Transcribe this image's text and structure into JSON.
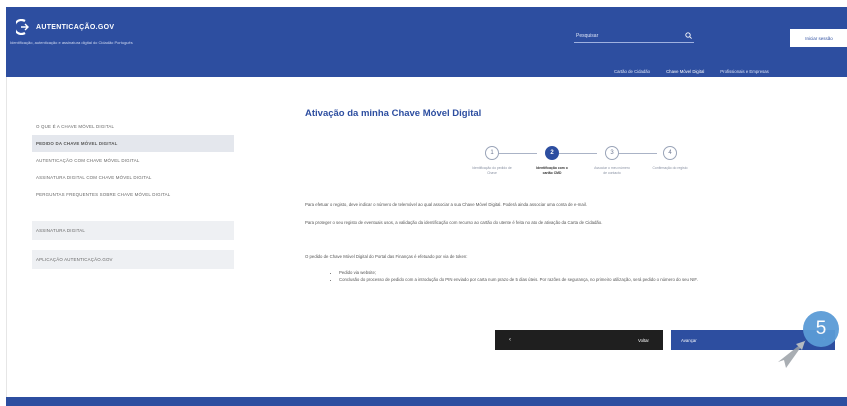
{
  "header": {
    "brand_name": "AUTENTICAÇÃO.GOV",
    "brand_sub": "Identificação, autenticação e assinatura digital do Cidadão Português",
    "search_placeholder": "Pesquisar",
    "login_label": "Iniciar sessão",
    "nav": [
      {
        "label": "Cartão de Cidadão",
        "active": false
      },
      {
        "label": "Chave Móvel Digital",
        "active": true
      },
      {
        "label": "Profissionais e Empresas",
        "active": false
      }
    ]
  },
  "sidebar": {
    "items": [
      {
        "label": "O QUE É A CHAVE MÓVEL DIGITAL",
        "active": false
      },
      {
        "label": "PEDIDO DA CHAVE MÓVEL DIGITAL",
        "active": true
      },
      {
        "label": "AUTENTICAÇÃO COM CHAVE MÓVEL DIGITAL",
        "active": false
      },
      {
        "label": "ASSINATURA DIGITAL COM CHAVE MÓVEL DIGITAL",
        "active": false
      },
      {
        "label": "PERGUNTAS FREQUENTES SOBRE CHAVE MÓVEL DIGITAL",
        "active": false
      }
    ],
    "blocks": [
      {
        "label": "ASSINATURA DIGITAL"
      },
      {
        "label": "APLICAÇÃO AUTENTICAÇÃO.GOV"
      }
    ]
  },
  "main": {
    "title": "Ativação da minha Chave Móvel Digital",
    "steps": [
      {
        "number": "1",
        "label": "Identificação do pedido de Chave",
        "active": false
      },
      {
        "number": "2",
        "label": "Identificação com o cartão CMD",
        "active": true
      },
      {
        "number": "3",
        "label": "Associar o meu número de contacto",
        "active": false
      },
      {
        "number": "4",
        "label": "Confirmação do registo",
        "active": false
      }
    ],
    "para1": "Para efetuar o registo, deve indicar o número de telemóvel ao qual associar a sua Chave Móvel Digital. Poderá ainda associar uma conta de e-mail.",
    "para2": "Para proteger o seu registo de eventuais usos, a validação da identificação com recurso ao cartão do utente é feita no ato de ativação da Carta de Cidadão.",
    "para3": "O pedido de Chave Móvel Digital do Portal das Finanças é efetuado por via de token:",
    "bullets": [
      "Pedido via website;",
      "Conclusão do processo de pedido com a introdução do PIN enviado por carta num prazo de 5 dias úteis. Por razões de segurança, no primeiro utilização, será pedido o número do seu NIF."
    ],
    "back_label": "Voltar",
    "back_icon": "‹",
    "next_label": "Avançar",
    "next_icon": "›"
  },
  "overlay": {
    "badge_number": "5"
  }
}
